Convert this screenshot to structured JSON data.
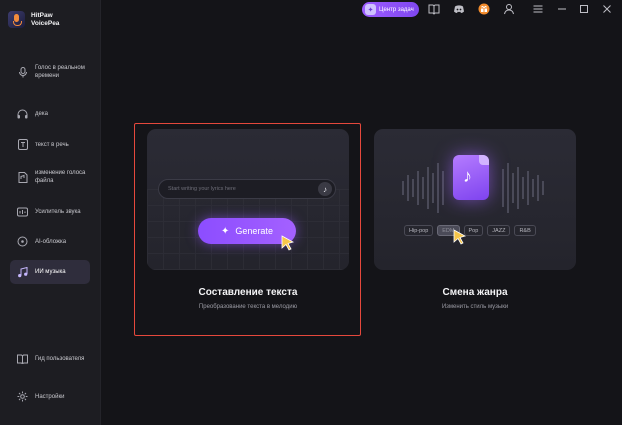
{
  "app": {
    "name_line1": "HitPaw",
    "name_line2": "VoicePea"
  },
  "sidebar": {
    "items": [
      {
        "label": "Голос в реальном времени",
        "icon": "microphone-icon"
      },
      {
        "label": "дека",
        "icon": "headphones-icon"
      },
      {
        "label": "текст в речь",
        "icon": "text-to-speech-icon"
      },
      {
        "label": "изменение голоса файла",
        "icon": "file-audio-icon"
      },
      {
        "label": "Усилитель звука",
        "icon": "volume-boost-icon"
      },
      {
        "label": "AI-обложка",
        "icon": "ai-cover-icon"
      },
      {
        "label": "ИИ музыка",
        "icon": "ai-music-icon",
        "active": true
      }
    ],
    "bottom": [
      {
        "label": "Гид пользователя",
        "icon": "guide-icon"
      },
      {
        "label": "Настройки",
        "icon": "gear-icon"
      }
    ]
  },
  "topbar": {
    "task_center_label": "Центр задач"
  },
  "cards": {
    "lyrics": {
      "title": "Составление текста",
      "subtitle": "Преобразование текста в мелодию",
      "input_placeholder": "Start writing your lyrics here",
      "generate_label": "Generate"
    },
    "genre": {
      "title": "Смена жанра",
      "subtitle": "Изменить стиль музыки",
      "tags": [
        "Hip-pop",
        "EDM",
        "Pop",
        "JAZZ",
        "R&B"
      ],
      "selected_tag": "EDM"
    }
  },
  "colors": {
    "accent": "#9d5cff",
    "highlight": "#e5483c",
    "background": "#141418",
    "sidebar": "#1d1d22"
  }
}
